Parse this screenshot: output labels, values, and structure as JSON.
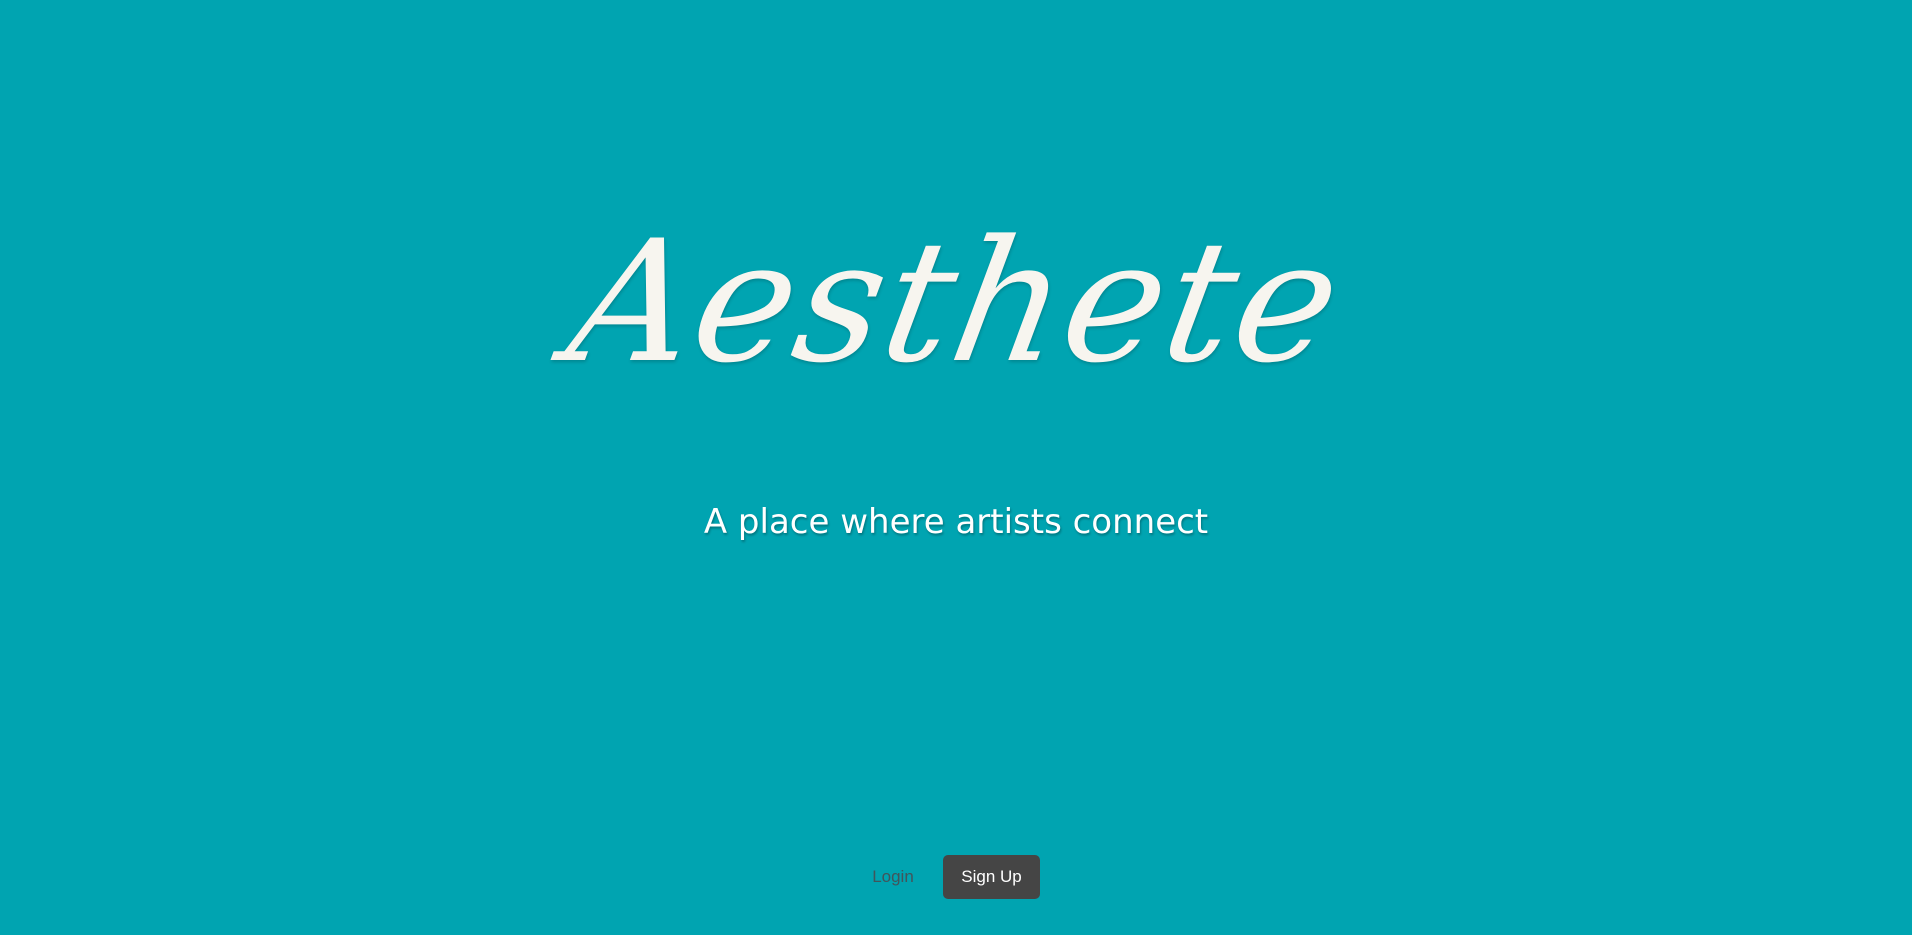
{
  "app": {
    "brand_name": "Aesthete",
    "tagline": "A place where artists connect"
  },
  "auth": {
    "login_label": "Login",
    "signup_label": "Sign Up"
  },
  "colors": {
    "background": "#00a4b1",
    "brand_text": "#f7f5ef",
    "signup_button_bg": "#454545"
  }
}
